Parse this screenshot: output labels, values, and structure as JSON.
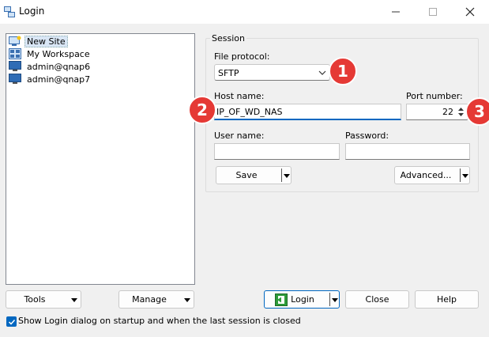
{
  "window": {
    "title": "Login",
    "minimize_icon": "minimize-icon",
    "maximize_icon": "maximize-icon",
    "close_icon": "close-icon"
  },
  "tree": {
    "items": [
      {
        "label": "New Site",
        "icon": "new-site-icon",
        "selected": true
      },
      {
        "label": "My Workspace",
        "icon": "workspace-icon",
        "selected": false
      },
      {
        "label": "admin@qnap6",
        "icon": "monitor-icon",
        "selected": false
      },
      {
        "label": "admin@qnap7",
        "icon": "monitor-icon",
        "selected": false
      }
    ]
  },
  "session": {
    "legend": "Session",
    "file_protocol_label": "File protocol:",
    "file_protocol_value": "SFTP",
    "host_label": "Host name:",
    "host_value": "IP_OF_WD_NAS",
    "port_label": "Port number:",
    "port_value": "22",
    "user_label": "User name:",
    "user_value": "",
    "password_label": "Password:",
    "password_value": "",
    "save_label": "Save",
    "advanced_label": "Advanced..."
  },
  "annotations": {
    "one": "1",
    "two": "2",
    "three": "3",
    "color": "#e53935"
  },
  "bottom": {
    "tools_label": "Tools",
    "manage_label": "Manage",
    "login_label": "Login",
    "close_label": "Close",
    "help_label": "Help",
    "show_login_label": "Show Login dialog on startup and when the last session is closed",
    "show_login_checked": true
  }
}
